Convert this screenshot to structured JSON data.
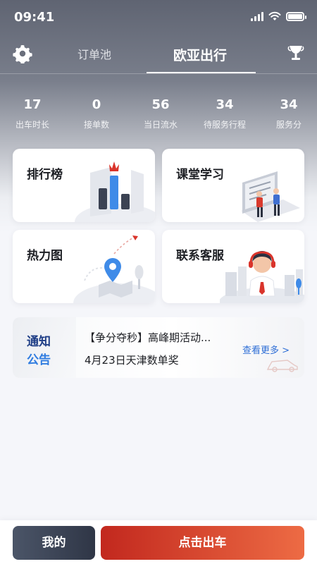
{
  "status_bar": {
    "time": "09:41"
  },
  "nav": {
    "tabs": [
      {
        "label": "订单池",
        "active": false
      },
      {
        "label": "欧亚出行",
        "active": true
      }
    ],
    "left_icon": "gear-icon",
    "right_icon": "trophy-icon"
  },
  "stats": [
    {
      "value": "17",
      "label": "出车时长"
    },
    {
      "value": "0",
      "label": "接单数"
    },
    {
      "value": "56",
      "label": "当日流水"
    },
    {
      "value": "34",
      "label": "待服务行程"
    },
    {
      "value": "34",
      "label": "服务分"
    }
  ],
  "cards": [
    {
      "title": "排行榜",
      "icon": "leaderboard-illustration"
    },
    {
      "title": "课堂学习",
      "icon": "classroom-illustration"
    },
    {
      "title": "热力图",
      "icon": "heatmap-illustration"
    },
    {
      "title": "联系客服",
      "icon": "customer-service-illustration"
    }
  ],
  "notice": {
    "badge_line1": "通知",
    "badge_line2": "公告",
    "headline": "【争分夺秒】高峰期活动...",
    "subline": "4月23日天津数单奖",
    "more_link": "查看更多 >"
  },
  "bottom": {
    "mine_label": "我的",
    "go_label": "点击出车"
  },
  "colors": {
    "accent_red": "#c2281e",
    "accent_orange": "#ed6b44",
    "dark_button": "#2f3646",
    "notice_blue": "#2f7ce0",
    "notice_navy": "#1f3e86"
  }
}
